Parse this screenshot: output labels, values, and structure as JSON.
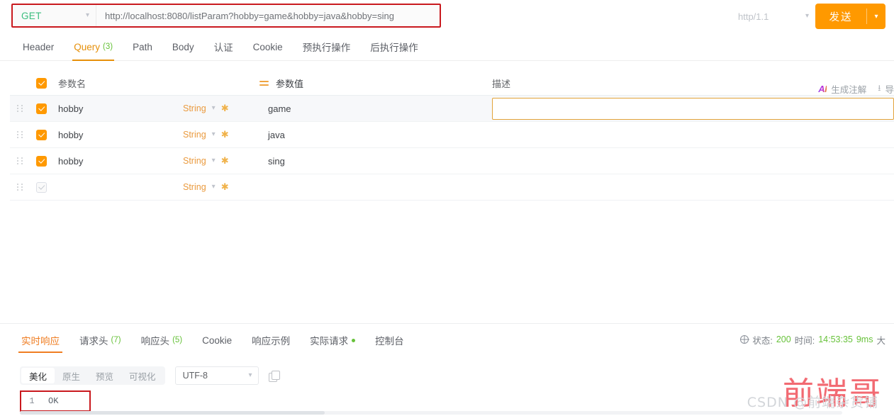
{
  "urlbar": {
    "method": "GET",
    "url": "http://localhost:8080/listParam?hobby=game&hobby=java&hobby=sing",
    "protocol": "http/1.1",
    "send_label": "发送"
  },
  "request_tabs": [
    {
      "label": "Header",
      "count": "",
      "active": false
    },
    {
      "label": "Query",
      "count": "(3)",
      "active": true
    },
    {
      "label": "Path",
      "count": "",
      "active": false
    },
    {
      "label": "Body",
      "count": "",
      "active": false
    },
    {
      "label": "认证",
      "count": "",
      "active": false
    },
    {
      "label": "Cookie",
      "count": "",
      "active": false
    },
    {
      "label": "预执行操作",
      "count": "",
      "active": false
    },
    {
      "label": "后执行操作",
      "count": "",
      "active": false
    }
  ],
  "param_table": {
    "headers": {
      "name": "参数名",
      "value": "参数值",
      "desc": "描述"
    },
    "actions": {
      "ai_logo": "AI",
      "ai_label": "生成注解",
      "export_icon": "download-icon",
      "export_label": "导"
    },
    "rows": [
      {
        "checked": true,
        "name": "hobby",
        "type": "String",
        "value": "game",
        "desc": "",
        "desc_focused": true,
        "hover": true
      },
      {
        "checked": true,
        "name": "hobby",
        "type": "String",
        "value": "java",
        "desc": "",
        "desc_focused": false,
        "hover": false
      },
      {
        "checked": true,
        "name": "hobby",
        "type": "String",
        "value": "sing",
        "desc": "",
        "desc_focused": false,
        "hover": false
      },
      {
        "checked": false,
        "name": "",
        "type": "String",
        "value": "",
        "desc": "",
        "desc_focused": false,
        "hover": false
      }
    ]
  },
  "response_tabs": [
    {
      "label": "实时响应",
      "count": "",
      "active": true,
      "dot": false
    },
    {
      "label": "请求头",
      "count": "(7)",
      "active": false,
      "dot": false
    },
    {
      "label": "响应头",
      "count": "(5)",
      "active": false,
      "dot": false
    },
    {
      "label": "Cookie",
      "count": "",
      "active": false,
      "dot": false
    },
    {
      "label": "响应示例",
      "count": "",
      "active": false,
      "dot": false
    },
    {
      "label": "实际请求",
      "count": "",
      "active": false,
      "dot": true
    },
    {
      "label": "控制台",
      "count": "",
      "active": false,
      "dot": false
    }
  ],
  "status": {
    "status_label": "状态:",
    "status_value": "200",
    "time_label": "时间:",
    "time_value": "14:53:35",
    "duration": "9ms",
    "size_label": "大"
  },
  "body_toolbar": {
    "segments": [
      {
        "label": "美化",
        "active": true
      },
      {
        "label": "原生",
        "active": false
      },
      {
        "label": "预览",
        "active": false
      },
      {
        "label": "可视化",
        "active": false
      }
    ],
    "encoding": "UTF-8",
    "copy_icon": "copy-icon"
  },
  "response_body": {
    "line_number": "1",
    "content": "OK"
  },
  "watermarks": {
    "red": "前端哥",
    "gray": "CSDN @前端杂货铺"
  },
  "colors": {
    "accent_orange": "#ff9900",
    "tab_active": "#e6900a",
    "method_green": "#3bbd7e",
    "annotation_red": "#c9191e",
    "status_green": "#67c23a"
  }
}
